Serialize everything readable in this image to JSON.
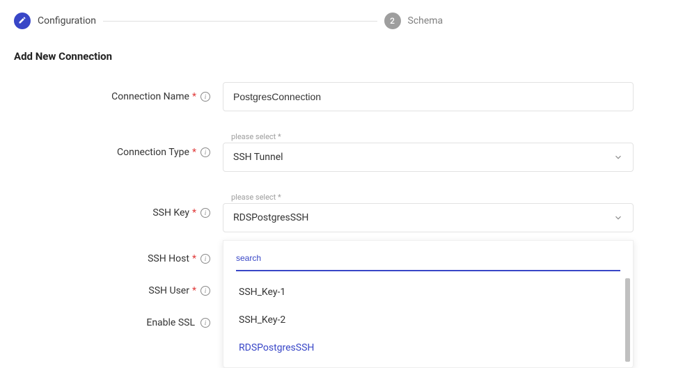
{
  "stepper": {
    "step1": {
      "label": "Configuration"
    },
    "step2": {
      "number": "2",
      "label": "Schema"
    }
  },
  "page": {
    "title": "Add New Connection"
  },
  "form": {
    "connection_name": {
      "label": "Connection Name",
      "value": "PostgresConnection"
    },
    "connection_type": {
      "label": "Connection Type",
      "float": "please select *",
      "value": "SSH Tunnel"
    },
    "ssh_key": {
      "label": "SSH Key",
      "float": "please select *",
      "value": "RDSPostgresSSH",
      "search_placeholder": "search",
      "options": [
        "SSH_Key-1",
        "SSH_Key-2",
        "RDSPostgresSSH"
      ]
    },
    "ssh_host": {
      "label": "SSH Host"
    },
    "ssh_user": {
      "label": "SSH User"
    },
    "enable_ssl": {
      "label": "Enable SSL"
    }
  }
}
